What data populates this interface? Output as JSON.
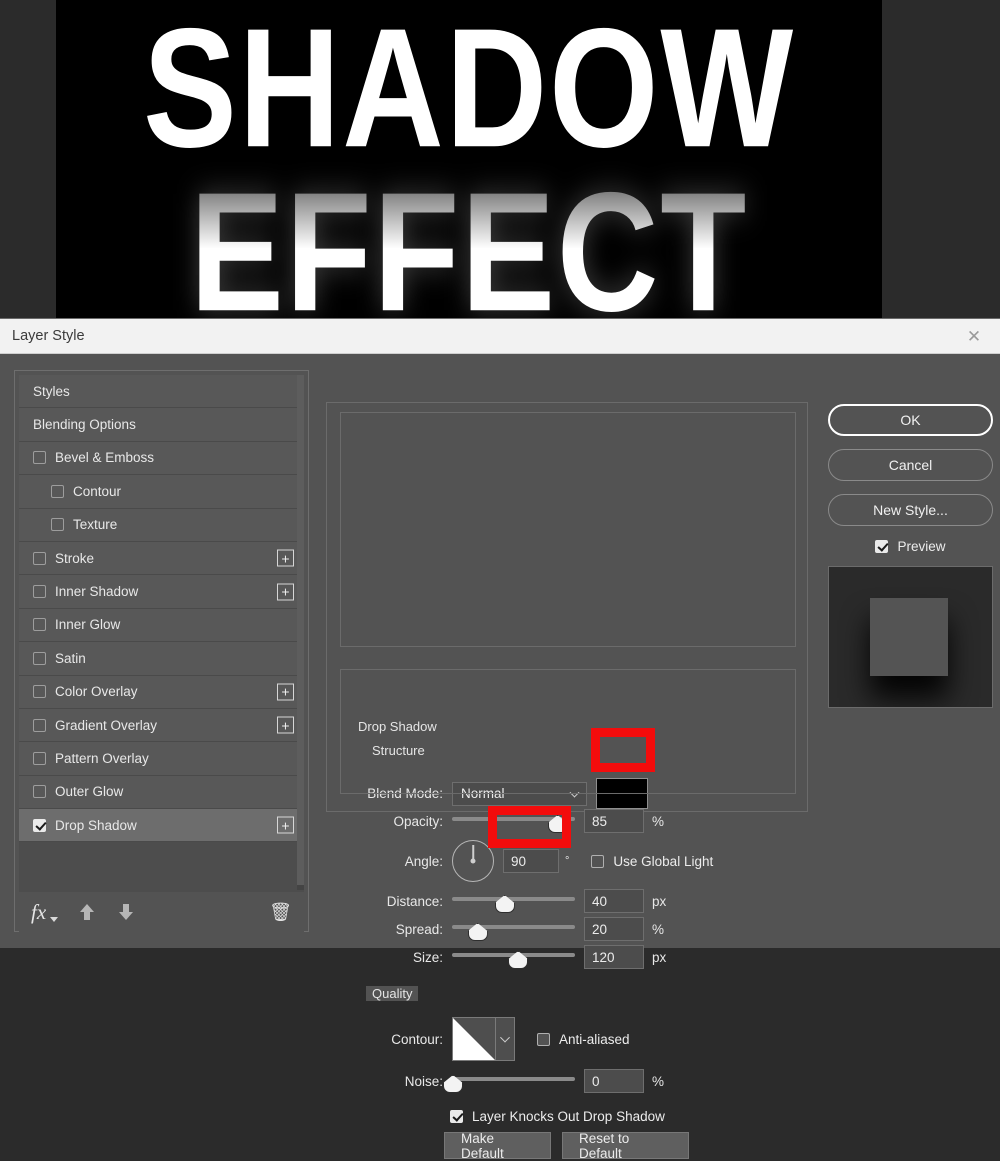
{
  "canvas": {
    "line1": "SHADOW",
    "line2": "EFFECT",
    "background_color": "#000000"
  },
  "dialog": {
    "title": "Layer Style",
    "close_icon": "close-icon"
  },
  "styles_panel": {
    "items": [
      {
        "label": "Styles",
        "type": "plain",
        "checkbox": null,
        "plus": false,
        "selected": false,
        "indent": false
      },
      {
        "label": "Blending Options",
        "type": "plain",
        "checkbox": null,
        "plus": false,
        "selected": false,
        "indent": false
      },
      {
        "label": "Bevel & Emboss",
        "type": "check",
        "checkbox": false,
        "plus": false,
        "selected": false,
        "indent": false
      },
      {
        "label": "Contour",
        "type": "check",
        "checkbox": false,
        "plus": false,
        "selected": false,
        "indent": true
      },
      {
        "label": "Texture",
        "type": "check",
        "checkbox": false,
        "plus": false,
        "selected": false,
        "indent": true
      },
      {
        "label": "Stroke",
        "type": "check",
        "checkbox": false,
        "plus": true,
        "selected": false,
        "indent": false
      },
      {
        "label": "Inner Shadow",
        "type": "check",
        "checkbox": false,
        "plus": true,
        "selected": false,
        "indent": false
      },
      {
        "label": "Inner Glow",
        "type": "check",
        "checkbox": false,
        "plus": false,
        "selected": false,
        "indent": false
      },
      {
        "label": "Satin",
        "type": "check",
        "checkbox": false,
        "plus": false,
        "selected": false,
        "indent": false
      },
      {
        "label": "Color Overlay",
        "type": "check",
        "checkbox": false,
        "plus": true,
        "selected": false,
        "indent": false
      },
      {
        "label": "Gradient Overlay",
        "type": "check",
        "checkbox": false,
        "plus": true,
        "selected": false,
        "indent": false
      },
      {
        "label": "Pattern Overlay",
        "type": "check",
        "checkbox": false,
        "plus": false,
        "selected": false,
        "indent": false
      },
      {
        "label": "Outer Glow",
        "type": "check",
        "checkbox": false,
        "plus": false,
        "selected": false,
        "indent": false
      },
      {
        "label": "Drop Shadow",
        "type": "check",
        "checkbox": true,
        "plus": true,
        "selected": true,
        "indent": false
      }
    ],
    "footer": {
      "fx_icon": "fx-icon",
      "move_up_icon": "arrow-up-icon",
      "move_down_icon": "arrow-down-icon",
      "delete_icon": "trash-icon"
    }
  },
  "effect_panel": {
    "group_title": "Drop Shadow",
    "structure": {
      "title": "Structure",
      "blend_mode": {
        "label": "Blend Mode:",
        "value": "Normal"
      },
      "color": {
        "swatch_color": "#000000"
      },
      "opacity": {
        "label": "Opacity:",
        "value": "85",
        "unit": "%",
        "percent": 85
      },
      "angle": {
        "label": "Angle:",
        "value": "90",
        "unit": "°",
        "dial_degrees": 90
      },
      "use_global_light": {
        "label": "Use Global Light",
        "checked": false
      },
      "distance": {
        "label": "Distance:",
        "value": "40",
        "unit": "px",
        "percent": 42
      },
      "spread": {
        "label": "Spread:",
        "value": "20",
        "unit": "%",
        "percent": 20
      },
      "size": {
        "label": "Size:",
        "value": "120",
        "unit": "px",
        "percent": 53
      }
    },
    "quality": {
      "title": "Quality",
      "contour": {
        "label": "Contour:"
      },
      "anti_aliased": {
        "label": "Anti-aliased",
        "checked": false
      },
      "noise": {
        "label": "Noise:",
        "value": "0",
        "unit": "%",
        "percent": 0
      }
    },
    "layer_knocks_out": {
      "label": "Layer Knocks Out Drop Shadow",
      "checked": true
    },
    "make_default": "Make Default",
    "reset_to_default": "Reset to Default"
  },
  "actions": {
    "ok": "OK",
    "cancel": "Cancel",
    "new_style": "New Style...",
    "preview": {
      "label": "Preview",
      "checked": true
    }
  },
  "annotations": {
    "highlight_color": "#f30c0c",
    "highlighted": [
      "shadow-color-swatch",
      "angle-value-field"
    ]
  }
}
